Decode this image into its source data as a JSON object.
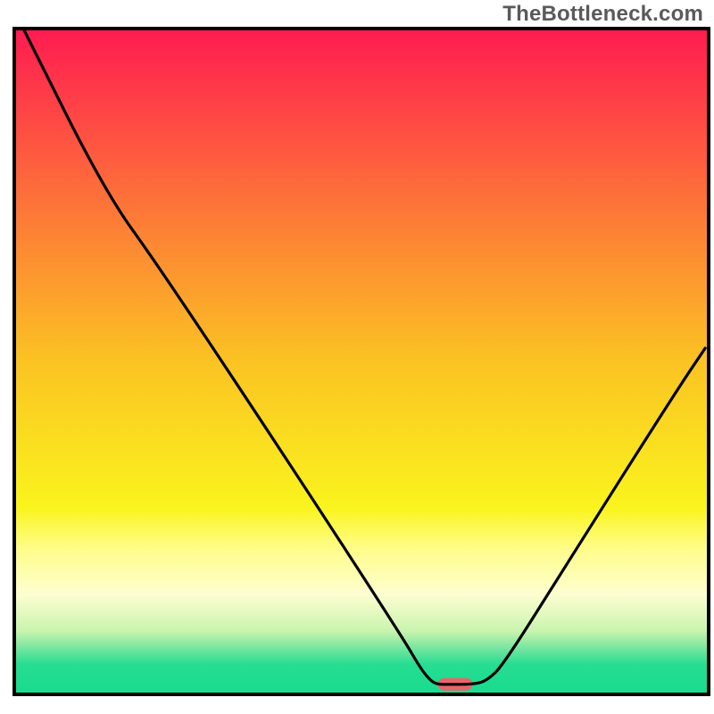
{
  "watermark": "TheBottleneck.com",
  "chart_data": {
    "type": "line",
    "title": "",
    "xlabel": "",
    "ylabel": "",
    "xlim": [
      0,
      100
    ],
    "ylim": [
      0,
      100
    ],
    "grid": false,
    "legend": false,
    "background_gradient": {
      "stops": [
        {
          "offset": 0.0,
          "color": "#ff1b51"
        },
        {
          "offset": 0.25,
          "color": "#fd6f3a"
        },
        {
          "offset": 0.5,
          "color": "#fbc323"
        },
        {
          "offset": 0.72,
          "color": "#faf41e"
        },
        {
          "offset": 0.78,
          "color": "#fffd88"
        },
        {
          "offset": 0.85,
          "color": "#fdfed1"
        },
        {
          "offset": 0.905,
          "color": "#c9f4ae"
        },
        {
          "offset": 0.93,
          "color": "#79e6a0"
        },
        {
          "offset": 0.955,
          "color": "#26dd92"
        },
        {
          "offset": 1.0,
          "color": "#17dc8f"
        }
      ]
    },
    "series": [
      {
        "name": "bottleneck-curve",
        "points": [
          {
            "x": 1.3,
            "y": 100.0
          },
          {
            "x": 13.0,
            "y": 75.6
          },
          {
            "x": 21.0,
            "y": 64.0
          },
          {
            "x": 40.5,
            "y": 33.3
          },
          {
            "x": 56.0,
            "y": 8.4
          },
          {
            "x": 58.5,
            "y": 3.9
          },
          {
            "x": 60.0,
            "y": 2.0
          },
          {
            "x": 61.0,
            "y": 1.5
          },
          {
            "x": 62.5,
            "y": 1.5
          },
          {
            "x": 66.0,
            "y": 1.5
          },
          {
            "x": 68.0,
            "y": 2.0
          },
          {
            "x": 70.5,
            "y": 4.5
          },
          {
            "x": 80.0,
            "y": 20.3
          },
          {
            "x": 95.0,
            "y": 45.0
          },
          {
            "x": 99.5,
            "y": 52.0
          }
        ]
      }
    ],
    "marker_range": {
      "x_start": 61.0,
      "x_end": 66.0,
      "y": 1.5,
      "color": "#e8656a"
    },
    "border_color": "#000000",
    "border_width": 4
  }
}
